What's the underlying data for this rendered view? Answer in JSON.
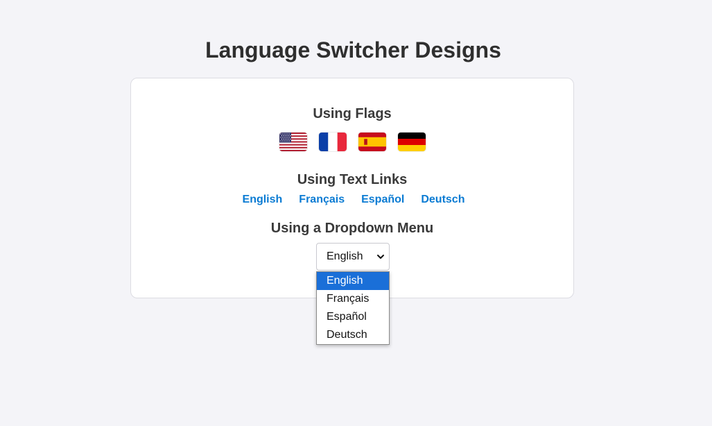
{
  "page": {
    "title": "Language Switcher Designs"
  },
  "sections": {
    "flags": {
      "heading": "Using Flags",
      "flags": [
        {
          "icon": "us-flag-icon",
          "country": "United States"
        },
        {
          "icon": "france-flag-icon",
          "country": "France"
        },
        {
          "icon": "spain-flag-icon",
          "country": "Spain"
        },
        {
          "icon": "germany-flag-icon",
          "country": "Germany"
        }
      ]
    },
    "text_links": {
      "heading": "Using Text Links",
      "links": [
        "English",
        "Français",
        "Español",
        "Deutsch"
      ]
    },
    "dropdown": {
      "heading": "Using a Dropdown Menu",
      "selected": "English",
      "options": [
        "English",
        "Français",
        "Español",
        "Deutsch"
      ],
      "highlighted_index": 0
    }
  },
  "colors": {
    "background": "#f4f4f8",
    "link": "#0a7bd3",
    "highlight": "#1a6fd8",
    "heading": "#3a3a3a"
  }
}
